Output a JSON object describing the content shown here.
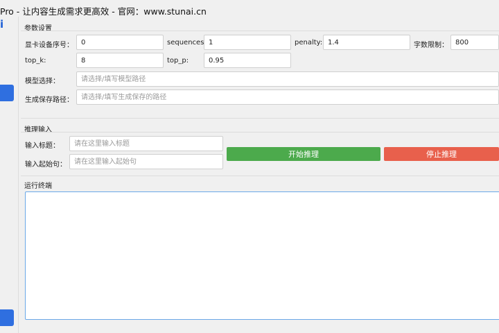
{
  "window": {
    "title": "Pro - 让内容生成需求更高效  -  官网：www.stunai.cn"
  },
  "sidebar": {
    "logo_text": "i"
  },
  "params": {
    "group_label": "参数设置",
    "gpu_label": "显卡设备序号：",
    "gpu_value": "0",
    "sequences_label": "sequences:",
    "sequences_value": "1",
    "penalty_label": "penalty:",
    "penalty_value": "1.4",
    "char_limit_label": "字数限制：",
    "char_limit_value": "800",
    "top_k_label": "top_k:",
    "top_k_value": "8",
    "top_p_label": "top_p:",
    "top_p_value": "0.95",
    "model_label": "模型选择：",
    "model_placeholder": "请选择/填写模型路径",
    "save_label": "生成保存路径：",
    "save_placeholder": "请选择/填写生成保存的路径"
  },
  "inference": {
    "group_label": "推理输入",
    "title_label": "输入标题：",
    "title_placeholder": "请在这里输入标题",
    "start_label": "输入起始句：",
    "start_placeholder": "请在这里输入起始句",
    "start_button": "开始推理",
    "stop_button": "停止推理"
  },
  "terminal": {
    "group_label": "运行终端"
  },
  "colors": {
    "accent": "#2f6fe0",
    "start": "#4caa4c",
    "stop": "#e8604c"
  }
}
